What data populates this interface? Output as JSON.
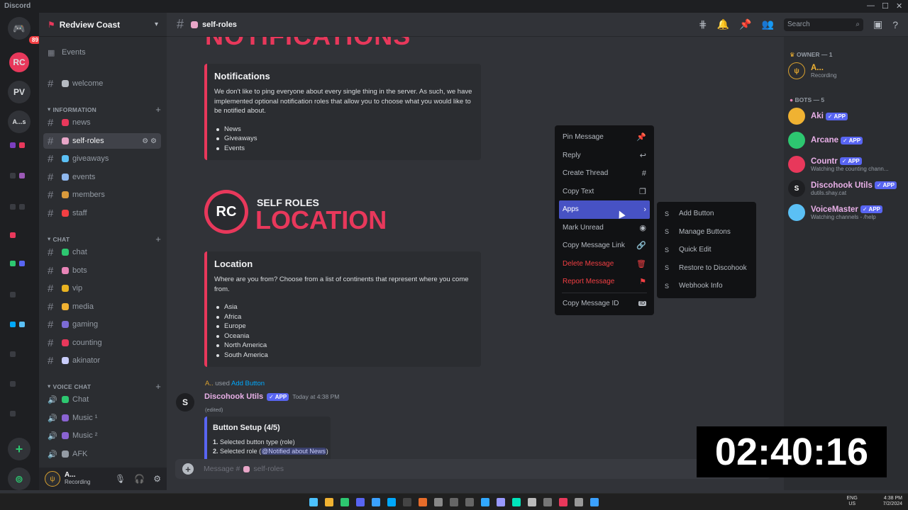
{
  "window": {
    "app_name": "Discord",
    "min": "—",
    "max": "☐",
    "close": "✕"
  },
  "guilds": {
    "home_badge": "89",
    "items": [
      "RC",
      "PV",
      "A...s"
    ]
  },
  "server": {
    "name": "Redview Coast"
  },
  "sidebar": {
    "events": "Events",
    "categories": {
      "information": "INFORMATION",
      "chat": "CHAT",
      "voice": "VOICE CHAT"
    },
    "channels": [
      {
        "name": "welcome",
        "emoji_color": "#b5bac1"
      },
      {
        "name": "news",
        "emoji_color": "#e8385b"
      },
      {
        "name": "self-roles",
        "emoji_color": "#e8a6c8"
      },
      {
        "name": "giveaways",
        "emoji_color": "#5bc0f5"
      },
      {
        "name": "events",
        "emoji_color": "#8fb8ee"
      },
      {
        "name": "members",
        "emoji_color": "#d99a3c"
      },
      {
        "name": "staff",
        "emoji_color": "#f23f43"
      },
      {
        "name": "chat",
        "emoji_color": "#2dc770"
      },
      {
        "name": "bots",
        "emoji_color": "#e884b7"
      },
      {
        "name": "vip",
        "emoji_color": "#e9b321"
      },
      {
        "name": "media",
        "emoji_color": "#f0b232"
      },
      {
        "name": "gaming",
        "emoji_color": "#7c6bd6"
      },
      {
        "name": "counting",
        "emoji_color": "#e8385b"
      },
      {
        "name": "akinator",
        "emoji_color": "#c9cdfb"
      }
    ],
    "voice": [
      {
        "name": "Chat",
        "emoji_color": "#2dc770"
      },
      {
        "name": "Music ¹",
        "emoji_color": "#8a63d2"
      },
      {
        "name": "Music ²",
        "emoji_color": "#8a63d2"
      },
      {
        "name": "AFK",
        "emoji_color": "#949ba4"
      }
    ]
  },
  "user": {
    "name": "A...",
    "status": "Recording"
  },
  "topbar": {
    "channel": "self-roles",
    "search_placeholder": "Search"
  },
  "content": {
    "banner_top": "NOTIFICATIONS",
    "notifications": {
      "title": "Notifications",
      "body": "We don't like to ping everyone about every single thing in the server. As such, we have implemented optional notification roles that allow you to choose what you would like to be notified about.",
      "items": [
        "News",
        "Giveaways",
        "Events"
      ]
    },
    "location_banner": {
      "logo": "RC",
      "sub": "SELF ROLES",
      "big": "LOCATION"
    },
    "location": {
      "title": "Location",
      "body": "Where are you from? Choose from a list of continents that represent where you come from.",
      "items": [
        "Asia",
        "Africa",
        "Europe",
        "Oceania",
        "North America",
        "South America"
      ]
    },
    "reply": {
      "user": "A..",
      "used": "used",
      "command": "Add Button"
    },
    "message": {
      "author": "Discohook Utils",
      "tag": "✓ APP",
      "timestamp": "Today at 4:38 PM",
      "edited": "(edited)",
      "embed_title": "Button Setup (4/5)",
      "line1_num": "1.",
      "line1": "Selected button type (role)",
      "line2_num": "2.",
      "line2_a": "Selected role (",
      "line2_mention": "@Notified about News",
      "line2_b": ")"
    }
  },
  "composer": {
    "placeholder": "Message #",
    "channel": "self-roles"
  },
  "members": {
    "owner_header": "OWNER — 1",
    "bots_header": "BOTS — 5",
    "owner": {
      "name": "A...",
      "sub": "Recording"
    },
    "bots": [
      {
        "name": "Aki",
        "tag": "✓ APP",
        "sub": "",
        "color": "#f0b232"
      },
      {
        "name": "Arcane",
        "tag": "✓ APP",
        "sub": "",
        "color": "#2dc770"
      },
      {
        "name": "Countr",
        "tag": "✓ APP",
        "sub": "Watching the counting chann...",
        "color": "#e8385b"
      },
      {
        "name": "Discohook Utils",
        "tag": "✓ APP",
        "sub": "dutils.shay.cat",
        "color": "#1e1f22"
      },
      {
        "name": "VoiceMaster",
        "tag": "✓ APP",
        "sub": "Watching channels - /help",
        "color": "#5bc0f5"
      }
    ]
  },
  "context_menu": {
    "items": [
      {
        "label": "Pin Message",
        "icon": "📌"
      },
      {
        "label": "Reply",
        "icon": "↩"
      },
      {
        "label": "Create Thread",
        "icon": "#"
      },
      {
        "label": "Copy Text",
        "icon": "❐"
      },
      {
        "label": "Apps",
        "icon": "›"
      },
      {
        "label": "Mark Unread",
        "icon": "◉"
      },
      {
        "label": "Copy Message Link",
        "icon": "🔗"
      },
      {
        "label": "Delete Message",
        "icon": "🗑"
      },
      {
        "label": "Report Message",
        "icon": "⚑"
      },
      {
        "label": "Copy Message ID",
        "icon": "ID"
      }
    ]
  },
  "apps_submenu": {
    "items": [
      "Add Button",
      "Manage Buttons",
      "Quick Edit",
      "Restore to Discohook",
      "Webhook Info"
    ]
  },
  "timer": "02:40:16",
  "tray": {
    "lang1": "ENG",
    "lang2": "US",
    "time": "4:38 PM",
    "date": "7/2/2024"
  }
}
